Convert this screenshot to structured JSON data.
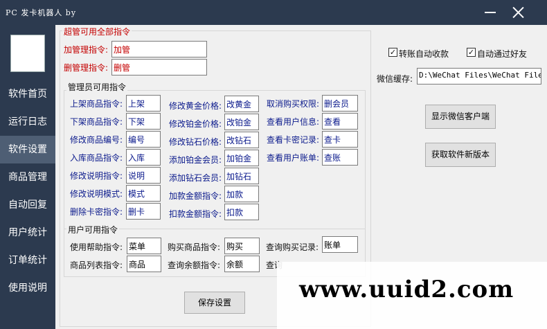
{
  "window": {
    "title": "PC 发卡机器人 by"
  },
  "sidebar": {
    "items": [
      {
        "label": "软件首页"
      },
      {
        "label": "运行日志"
      },
      {
        "label": "软件设置"
      },
      {
        "label": "商品管理"
      },
      {
        "label": "自动回复"
      },
      {
        "label": "用户统计"
      },
      {
        "label": "订单统计"
      },
      {
        "label": "使用说明"
      }
    ],
    "active_index": 2
  },
  "super_group": {
    "title": "超管可用全部指令",
    "fields": [
      {
        "label": "加管理指令:",
        "value": "加管"
      },
      {
        "label": "删管理指令:",
        "value": "删管"
      }
    ]
  },
  "admin_group": {
    "title": "管理员可用指令",
    "col1": [
      {
        "label": "上架商品指令:",
        "value": "上架"
      },
      {
        "label": "下架商品指令:",
        "value": "下架"
      },
      {
        "label": "修改商品编号:",
        "value": "编号"
      },
      {
        "label": "入库商品指令:",
        "value": "入库"
      },
      {
        "label": "修改说明指令:",
        "value": "说明"
      },
      {
        "label": "修改说明模式:",
        "value": "模式"
      },
      {
        "label": "删除卡密指令:",
        "value": "删卡"
      }
    ],
    "col2": [
      {
        "label": "修改黄金价格:",
        "value": "改黄金"
      },
      {
        "label": "修改铂金价格:",
        "value": "改铂金"
      },
      {
        "label": "修改钻石价格:",
        "value": "改钻石"
      },
      {
        "label": "添加铂金会员:",
        "value": "加铂金"
      },
      {
        "label": "添加钻石会员:",
        "value": "加钻石"
      },
      {
        "label": "加款金额指令:",
        "value": "加款"
      },
      {
        "label": "扣款金额指令:",
        "value": "扣款"
      }
    ],
    "col3": [
      {
        "label": "取消购买权限:",
        "value": "删会员"
      },
      {
        "label": "查看用户信息:",
        "value": "查看"
      },
      {
        "label": "查看卡密记录:",
        "value": "查卡"
      },
      {
        "label": "查看用户账单:",
        "value": "查账"
      }
    ]
  },
  "user_group": {
    "title": "用户可用指令",
    "row1": [
      {
        "label": "使用帮助指令:",
        "value": "菜单"
      },
      {
        "label": "购买商品指令:",
        "value": "购买"
      },
      {
        "label": "查询购买记录:",
        "value": "账单"
      }
    ],
    "row2": [
      {
        "label": "商品列表指令:",
        "value": "商品"
      },
      {
        "label": "查询余额指令:",
        "value": "余额"
      },
      {
        "label": "查询",
        "value": ""
      }
    ]
  },
  "options": {
    "auto_receive": {
      "label": "转账自动收款",
      "checked": true
    },
    "auto_friend": {
      "label": "自动通过好友",
      "checked": true
    },
    "wechat_cache_label": "微信缓存:",
    "wechat_cache_value": "D:\\WeChat Files\\WeChat Files"
  },
  "buttons": {
    "show_wechat": "显示微信客户端",
    "get_version": "获取软件新版本",
    "save": "保存设置"
  },
  "check_mark": "✓",
  "watermark": "www.uuid2.com"
}
